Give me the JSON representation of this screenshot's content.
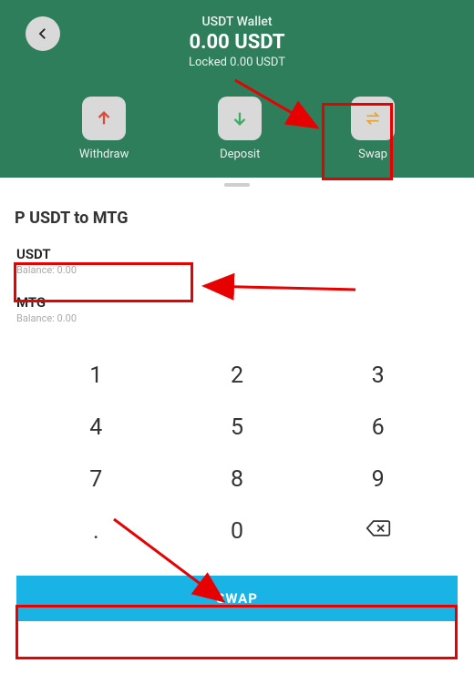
{
  "colors": {
    "header_bg": "#2E7D5B",
    "swap_btn": "#1AB3E6",
    "annotation": "#E60000",
    "withdraw_arrow": "#D94A3A",
    "deposit_arrow": "#3AAE5F",
    "swap_icon": "#E8A33D"
  },
  "header": {
    "wallet_name": "USDT Wallet",
    "balance": "0.00 USDT",
    "locked": "Locked 0.00 USDT"
  },
  "actions": {
    "withdraw": "Withdraw",
    "deposit": "Deposit",
    "swap": "Swap"
  },
  "sheet": {
    "title": "P USDT to MTG",
    "from_currency": "USDT",
    "from_balance": "Balance: 0.00",
    "to_currency": "MTG",
    "to_balance": "Balance: 0.00"
  },
  "keypad": {
    "k1": "1",
    "k2": "2",
    "k3": "3",
    "k4": "4",
    "k5": "5",
    "k6": "6",
    "k7": "7",
    "k8": "8",
    "k9": "9",
    "kdot": ".",
    "k0": "0"
  },
  "swap_button": "SWAP"
}
